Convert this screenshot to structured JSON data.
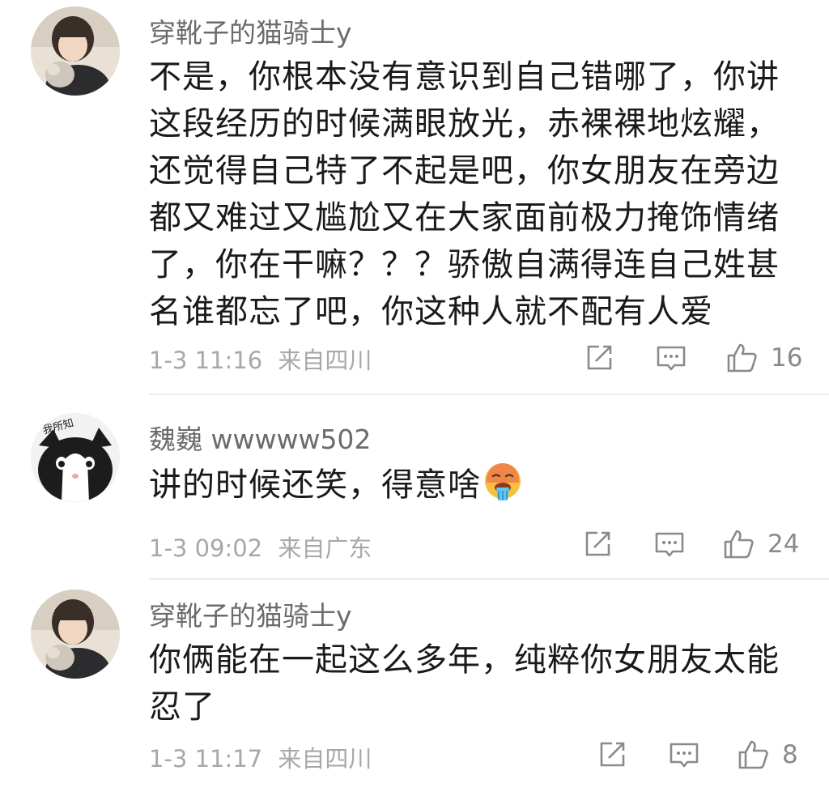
{
  "comments": [
    {
      "username": "穿靴子的猫骑士y",
      "content": "不是，你根本没有意识到自己错哪了，你讲这段经历的时候满眼放光，赤裸裸地炫耀，还觉得自己特了不起是吧，你女朋友在旁边都又难过又尴尬又在大家面前极力掩饰情绪了，你在干嘛？？？骄傲自满得连自己姓甚名谁都忘了吧，你这种人就不配有人爱",
      "date": "1-3 11:16",
      "location": "来自四川",
      "likes": "16",
      "avatar_icon": "girl-avatar-icon"
    },
    {
      "username": "魏巍 wwwww502",
      "content": "讲的时候还笑，得意啥",
      "emoji": "drooling-hot-face-emoji",
      "date": "1-3 09:02",
      "location": "来自广东",
      "likes": "24",
      "avatar_icon": "cat-avatar-icon",
      "avatar_text": "我所知"
    },
    {
      "username": "穿靴子的猫骑士y",
      "content": "你俩能在一起这么多年，纯粹你女朋友太能忍了",
      "date": "1-3 11:17",
      "location": "来自四川",
      "likes": "8",
      "avatar_icon": "girl-avatar-icon"
    }
  ],
  "colors": {
    "username": "#6b6b6b",
    "text": "#1a1a1a",
    "meta": "#a8a8a8",
    "icon": "#8a8a8a",
    "divider": "#ececec"
  }
}
